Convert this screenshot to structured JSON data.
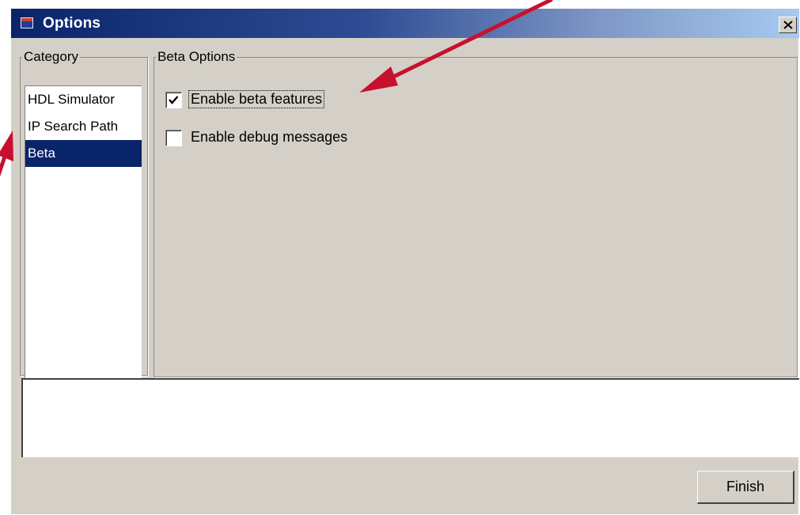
{
  "window": {
    "title": "Options",
    "close_glyph": "×"
  },
  "category": {
    "legend": "Category",
    "items": [
      {
        "label": "HDL Simulator",
        "selected": false
      },
      {
        "label": "IP Search Path",
        "selected": false
      },
      {
        "label": "Beta",
        "selected": true
      }
    ]
  },
  "beta_options": {
    "legend": "Beta Options",
    "checkboxes": [
      {
        "label": "Enable beta features",
        "checked": true
      },
      {
        "label": "Enable debug messages",
        "checked": false
      }
    ]
  },
  "message_area": {
    "text": ""
  },
  "buttons": {
    "finish_label": "Finish"
  },
  "annotations": {
    "arrow_color": "#c8102e"
  },
  "colors": {
    "title_gradient_start": "#0a246a",
    "title_gradient_end": "#a6caf0",
    "dialog_bg": "#d4d0c8",
    "selection_bg": "#0a246a"
  }
}
